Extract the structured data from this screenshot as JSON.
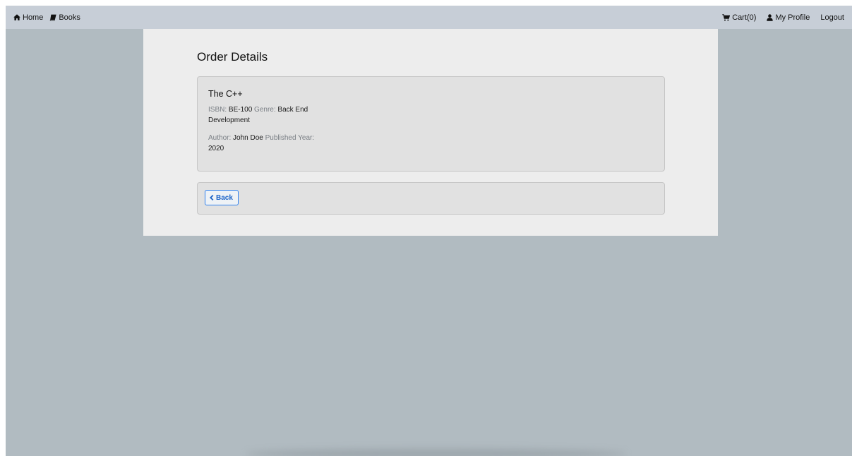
{
  "nav": {
    "home": {
      "label": "Home",
      "icon": "home-icon"
    },
    "books": {
      "label": "Books",
      "icon": "book-icon"
    },
    "cart": {
      "label": "Cart(0)",
      "icon": "cart-icon"
    },
    "profile": {
      "label": "My Profile",
      "icon": "user-icon"
    },
    "logout": {
      "label": "Logout"
    }
  },
  "page": {
    "title": "Order Details"
  },
  "book": {
    "title": "The C++",
    "isbn_label": "ISBN:",
    "isbn": "BE-100",
    "genre_label": "Genre:",
    "genre": "Back End Development",
    "author_label": "Author:",
    "author": "John Doe",
    "year_label": "Published Year:",
    "year": "2020"
  },
  "actions": {
    "back_label": "Back",
    "back_icon": "chevron-left-icon"
  },
  "colors": {
    "background": "#b1bbc1",
    "navbar": "#c7ced7",
    "panel": "#ededed",
    "card": "#e1e1e1",
    "accent": "#2f80ed"
  }
}
